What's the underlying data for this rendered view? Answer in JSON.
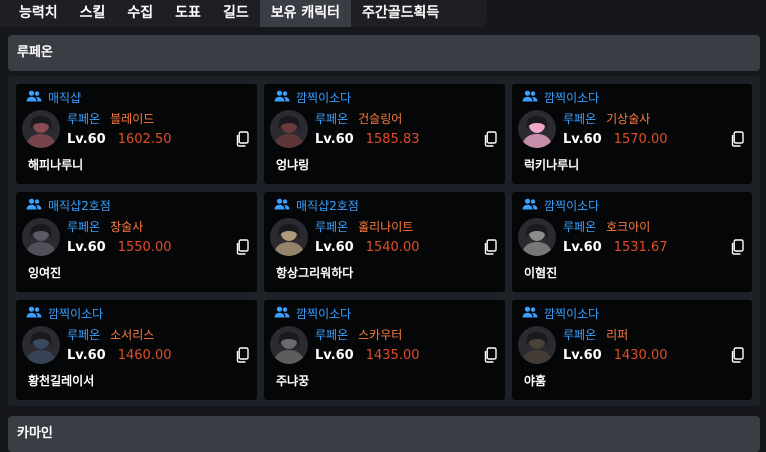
{
  "tabs": [
    {
      "label": "능력치",
      "active": false
    },
    {
      "label": "스킬",
      "active": false
    },
    {
      "label": "수집",
      "active": false
    },
    {
      "label": "도표",
      "active": false
    },
    {
      "label": "길드",
      "active": false
    },
    {
      "label": "보유 캐릭터",
      "active": true
    },
    {
      "label": "주간골드획득",
      "active": false
    }
  ],
  "sections": [
    {
      "title": "루페온"
    },
    {
      "title": "카마인"
    }
  ],
  "cards": [
    {
      "guild": "매직샵",
      "server": "루페온",
      "class": "블레이드",
      "level": "Lv.60",
      "item_level": "1602.50",
      "name": "해피나루니",
      "avatar_color": "#8a4a52"
    },
    {
      "guild": "깜찍이소다",
      "server": "루페온",
      "class": "건슬링어",
      "level": "Lv.60",
      "item_level": "1585.83",
      "name": "엉냐링",
      "avatar_color": "#6b3a3a"
    },
    {
      "guild": "깜찍이소다",
      "server": "루페온",
      "class": "기상술사",
      "level": "Lv.60",
      "item_level": "1570.00",
      "name": "럭키나루니",
      "avatar_color": "#f0a8c8"
    },
    {
      "guild": "매직샵2호점",
      "server": "루페온",
      "class": "창술사",
      "level": "Lv.60",
      "item_level": "1550.00",
      "name": "잉여진",
      "avatar_color": "#5a5a66"
    },
    {
      "guild": "매직샵2호점",
      "server": "루페온",
      "class": "홀리나이트",
      "level": "Lv.60",
      "item_level": "1540.00",
      "name": "항상그리워하다",
      "avatar_color": "#b09a7a"
    },
    {
      "guild": "깜찍이소다",
      "server": "루페온",
      "class": "호크아이",
      "level": "Lv.60",
      "item_level": "1531.67",
      "name": "이혐진",
      "avatar_color": "#8c8c8c"
    },
    {
      "guild": "깜찍이소다",
      "server": "루페온",
      "class": "소서리스",
      "level": "Lv.60",
      "item_level": "1460.00",
      "name": "황천길레이서",
      "avatar_color": "#3a4a5e"
    },
    {
      "guild": "깜찍이소다",
      "server": "루페온",
      "class": "스카우터",
      "level": "Lv.60",
      "item_level": "1435.00",
      "name": "주냐꿍",
      "avatar_color": "#6a6a6a"
    },
    {
      "guild": "깜찍이소다",
      "server": "루페온",
      "class": "리퍼",
      "level": "Lv.60",
      "item_level": "1430.00",
      "name": "야훔",
      "avatar_color": "#4a4038"
    }
  ],
  "colors": {
    "accent_blue": "#3aa0ff",
    "class_orange": "#ff7a3d",
    "item_level_red": "#e04e2a",
    "section_header_bg": "#3a3d44",
    "card_bg": "#050608"
  },
  "icons": {
    "guild": "users-icon",
    "copy": "copy-icon"
  }
}
